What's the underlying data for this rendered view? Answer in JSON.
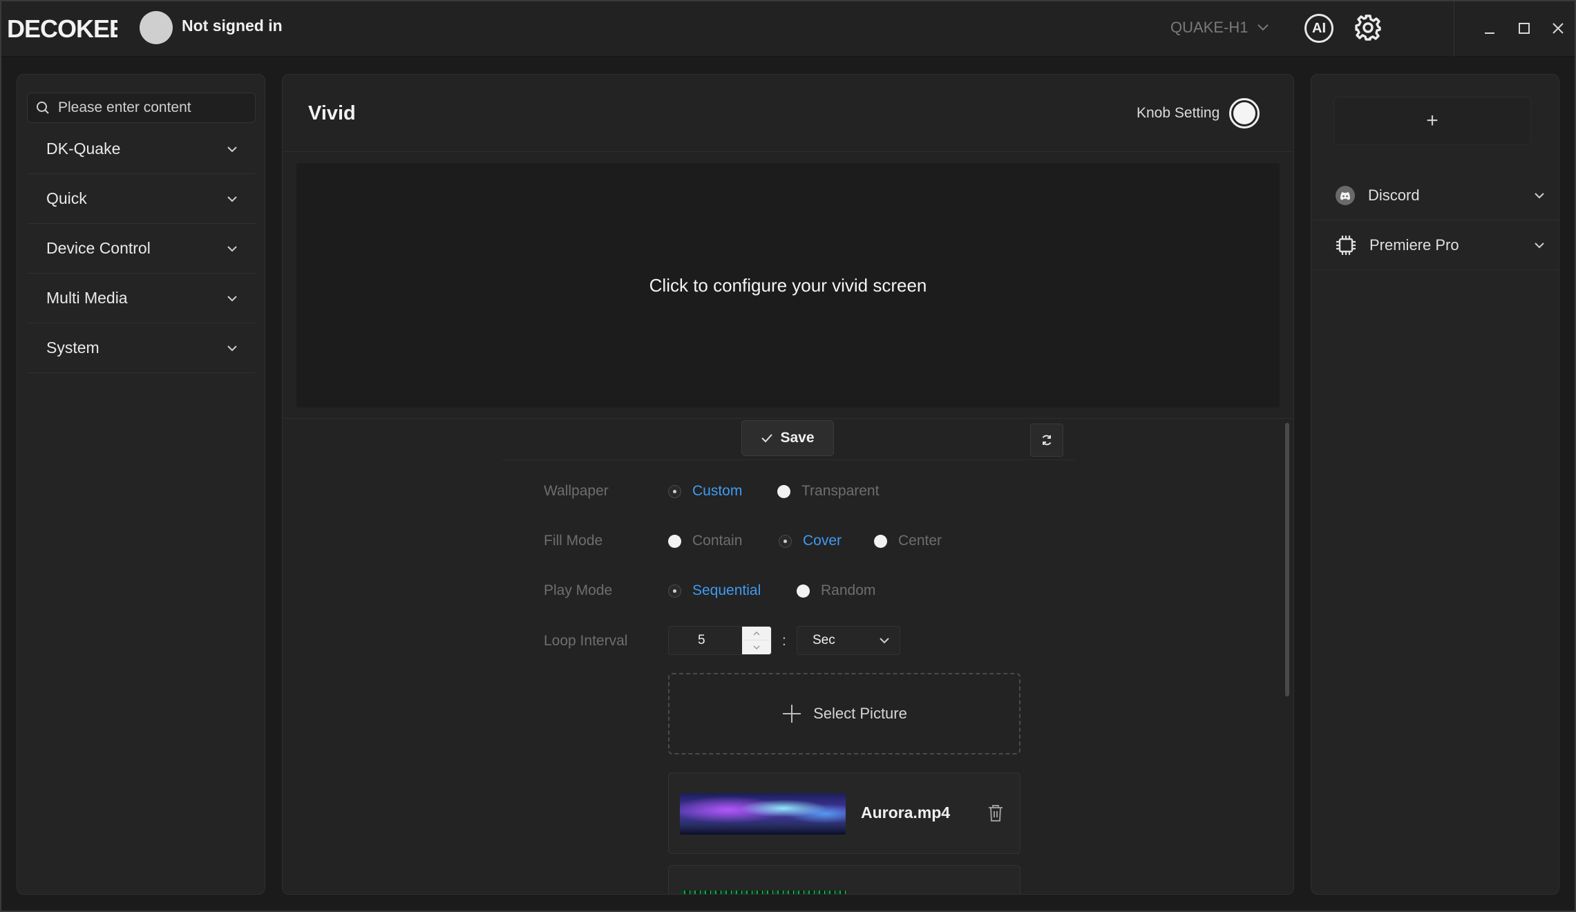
{
  "app": {
    "logo_text": "DECOKEE",
    "user_status": "Not signed in",
    "device_name": "QUAKE-H1",
    "ai_label": "AI"
  },
  "sidebar": {
    "search_placeholder": "Please enter content",
    "categories": [
      {
        "label": "DK-Quake"
      },
      {
        "label": "Quick"
      },
      {
        "label": "Device Control"
      },
      {
        "label": "Multi Media"
      },
      {
        "label": "System"
      }
    ]
  },
  "main": {
    "title": "Vivid",
    "knob_setting_label": "Knob Setting",
    "knob_setting_enabled": true,
    "preview_text": "Click to configure your vivid screen",
    "save_label": "Save",
    "settings": {
      "wallpaper": {
        "label": "Wallpaper",
        "options": [
          "Custom",
          "Transparent"
        ],
        "selected": "Custom"
      },
      "fill_mode": {
        "label": "Fill Mode",
        "options": [
          "Contain",
          "Cover",
          "Center"
        ],
        "selected": "Cover"
      },
      "play_mode": {
        "label": "Play Mode",
        "options": [
          "Sequential",
          "Random"
        ],
        "selected": "Sequential"
      },
      "loop_interval": {
        "label": "Loop Interval",
        "value": "5",
        "separator": ":",
        "unit": "Sec"
      }
    },
    "select_picture_label": "Select Picture",
    "files": [
      {
        "name": "Aurora.mp4"
      }
    ]
  },
  "right_panel": {
    "add_label": "+",
    "apps": [
      {
        "label": "Discord",
        "icon": "discord-icon"
      },
      {
        "label": "Premiere Pro",
        "icon": "chip-icon"
      }
    ]
  },
  "colors": {
    "accent": "#3f9bf2",
    "background": "#1b1b1b",
    "panel": "#242424"
  }
}
